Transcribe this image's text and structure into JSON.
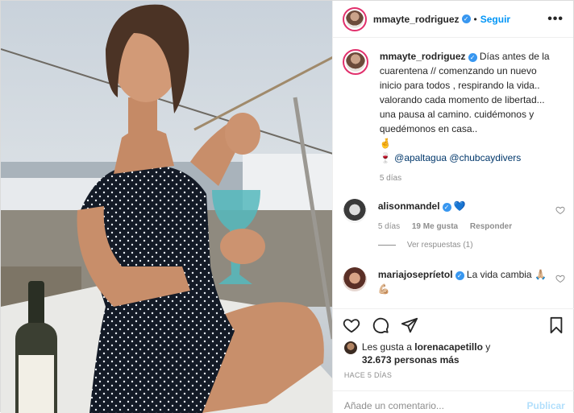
{
  "post": {
    "username": "mmayte_rodriguez",
    "separator": "•",
    "follow_label": "Seguir",
    "more_label": "•••"
  },
  "caption": {
    "username": "mmayte_rodriguez",
    "text": "Días antes de la cuarentena // comenzando un nuevo inicio para todos , respirando la vida.. valorando cada momento de libertad... una pausa al camino. cuidémonos y quedémonos en casa..",
    "emoji": "🤞",
    "emoji2": "🍷",
    "mention1": "@apaltagua",
    "mention2": "@chubcaydivers",
    "time": "5 días"
  },
  "comments": [
    {
      "username": "alisonmandel",
      "text": "💙",
      "time": "5 días",
      "likes": "19 Me gusta",
      "reply": "Responder",
      "view_replies": "Ver respuestas (1)"
    },
    {
      "username": "mariajosepríetol",
      "text": "La vida cambia 🙏🏼💪🏼"
    }
  ],
  "likes": {
    "prefix": "Les gusta a",
    "user": "lorenacapetillo",
    "middle": "y",
    "others": "32.673 personas más"
  },
  "timestamp": "HACE 5 DÍAS",
  "comment_box": {
    "placeholder": "Añade un comentario...",
    "publish_label": "Publicar"
  },
  "colors": {
    "accent": "#0095f6",
    "verified": "#3897f0",
    "muted": "#8e8e8e",
    "publish_disabled": "#b2dffc"
  }
}
